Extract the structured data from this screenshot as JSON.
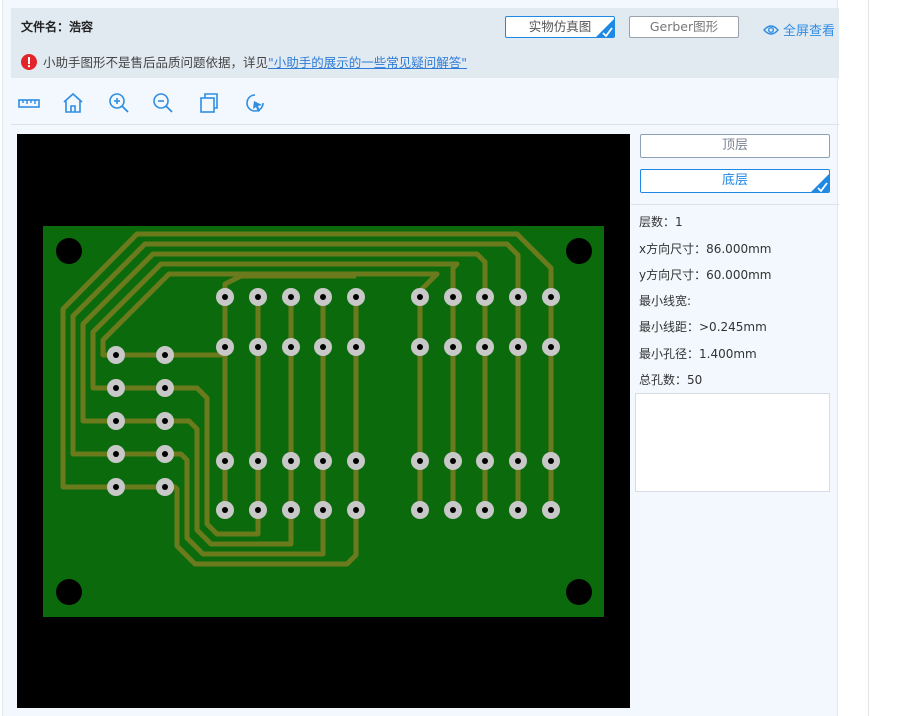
{
  "header": {
    "filename_label": "文件名：浩容",
    "simulate_label": "实物仿真图",
    "gerber_label": "Gerber图形",
    "fullscreen_label": "全屏查看",
    "warning_text": "小助手图形不是售后品质问题依据，详见",
    "warning_link": "\"小助手的展示的一些常见疑问解答\""
  },
  "toolbar": {
    "tools": [
      "ruler-icon",
      "home-icon",
      "zoom-in-icon",
      "zoom-out-icon",
      "copy-icon",
      "pointer-refresh-icon"
    ]
  },
  "layers": {
    "top_label": "顶层",
    "bottom_label": "底层",
    "active": "bottom"
  },
  "stats": {
    "layers": "层数：1",
    "x_size": "x方向尺寸：86.000mm",
    "y_size": "y方向尺寸：60.000mm",
    "min_width": "最小线宽:",
    "min_spacing": "最小线距：>0.245mm",
    "min_hole": "最小孔径：1.400mm",
    "total_holes": "总孔数：50"
  },
  "colors": {
    "pcb_green": "#0b6a0c",
    "trace": "#6b7a1c",
    "pad": "#c8c8c8",
    "accent": "#1e88e5"
  }
}
